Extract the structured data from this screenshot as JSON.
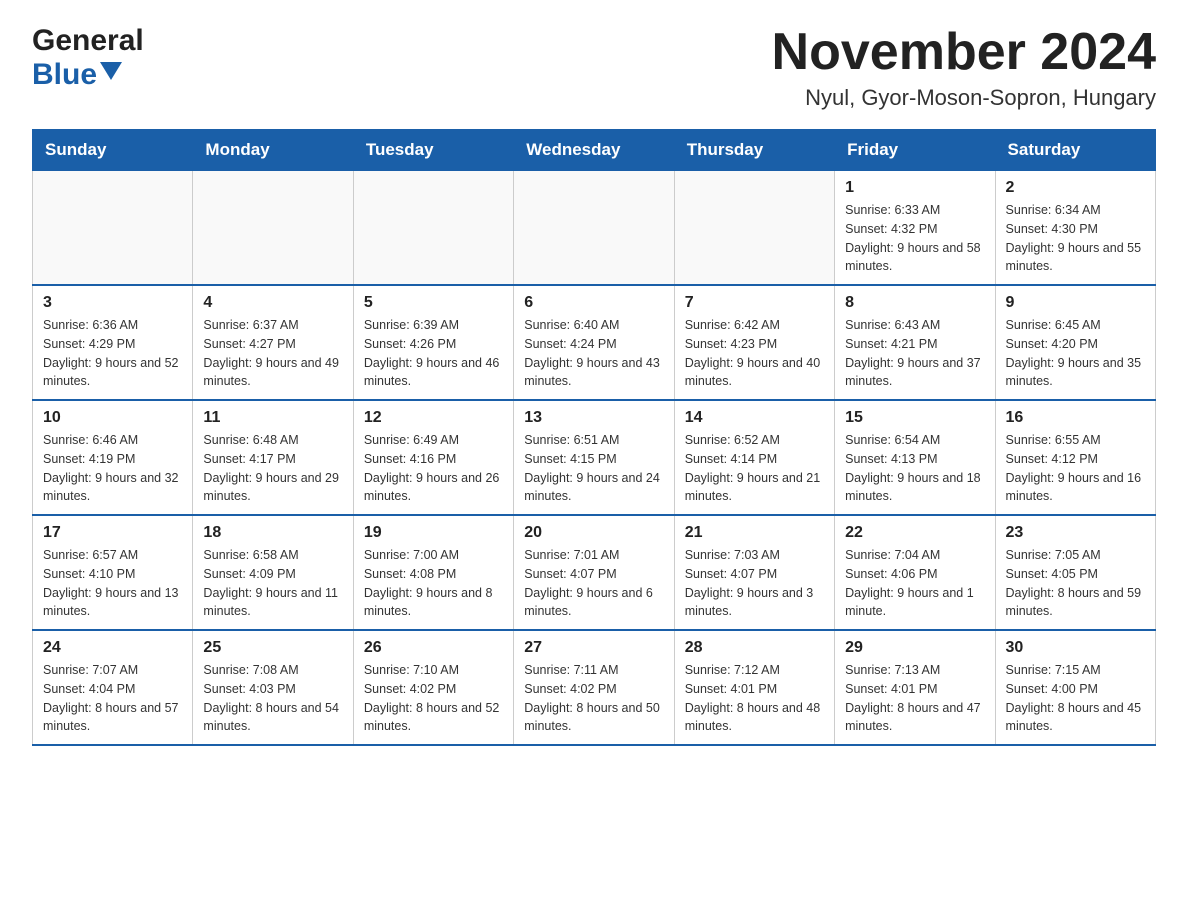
{
  "header": {
    "logo_general": "General",
    "logo_blue": "Blue",
    "month_title": "November 2024",
    "location": "Nyul, Gyor-Moson-Sopron, Hungary"
  },
  "calendar": {
    "days_of_week": [
      "Sunday",
      "Monday",
      "Tuesday",
      "Wednesday",
      "Thursday",
      "Friday",
      "Saturday"
    ],
    "weeks": [
      [
        {
          "day": "",
          "info": ""
        },
        {
          "day": "",
          "info": ""
        },
        {
          "day": "",
          "info": ""
        },
        {
          "day": "",
          "info": ""
        },
        {
          "day": "",
          "info": ""
        },
        {
          "day": "1",
          "info": "Sunrise: 6:33 AM\nSunset: 4:32 PM\nDaylight: 9 hours and 58 minutes."
        },
        {
          "day": "2",
          "info": "Sunrise: 6:34 AM\nSunset: 4:30 PM\nDaylight: 9 hours and 55 minutes."
        }
      ],
      [
        {
          "day": "3",
          "info": "Sunrise: 6:36 AM\nSunset: 4:29 PM\nDaylight: 9 hours and 52 minutes."
        },
        {
          "day": "4",
          "info": "Sunrise: 6:37 AM\nSunset: 4:27 PM\nDaylight: 9 hours and 49 minutes."
        },
        {
          "day": "5",
          "info": "Sunrise: 6:39 AM\nSunset: 4:26 PM\nDaylight: 9 hours and 46 minutes."
        },
        {
          "day": "6",
          "info": "Sunrise: 6:40 AM\nSunset: 4:24 PM\nDaylight: 9 hours and 43 minutes."
        },
        {
          "day": "7",
          "info": "Sunrise: 6:42 AM\nSunset: 4:23 PM\nDaylight: 9 hours and 40 minutes."
        },
        {
          "day": "8",
          "info": "Sunrise: 6:43 AM\nSunset: 4:21 PM\nDaylight: 9 hours and 37 minutes."
        },
        {
          "day": "9",
          "info": "Sunrise: 6:45 AM\nSunset: 4:20 PM\nDaylight: 9 hours and 35 minutes."
        }
      ],
      [
        {
          "day": "10",
          "info": "Sunrise: 6:46 AM\nSunset: 4:19 PM\nDaylight: 9 hours and 32 minutes."
        },
        {
          "day": "11",
          "info": "Sunrise: 6:48 AM\nSunset: 4:17 PM\nDaylight: 9 hours and 29 minutes."
        },
        {
          "day": "12",
          "info": "Sunrise: 6:49 AM\nSunset: 4:16 PM\nDaylight: 9 hours and 26 minutes."
        },
        {
          "day": "13",
          "info": "Sunrise: 6:51 AM\nSunset: 4:15 PM\nDaylight: 9 hours and 24 minutes."
        },
        {
          "day": "14",
          "info": "Sunrise: 6:52 AM\nSunset: 4:14 PM\nDaylight: 9 hours and 21 minutes."
        },
        {
          "day": "15",
          "info": "Sunrise: 6:54 AM\nSunset: 4:13 PM\nDaylight: 9 hours and 18 minutes."
        },
        {
          "day": "16",
          "info": "Sunrise: 6:55 AM\nSunset: 4:12 PM\nDaylight: 9 hours and 16 minutes."
        }
      ],
      [
        {
          "day": "17",
          "info": "Sunrise: 6:57 AM\nSunset: 4:10 PM\nDaylight: 9 hours and 13 minutes."
        },
        {
          "day": "18",
          "info": "Sunrise: 6:58 AM\nSunset: 4:09 PM\nDaylight: 9 hours and 11 minutes."
        },
        {
          "day": "19",
          "info": "Sunrise: 7:00 AM\nSunset: 4:08 PM\nDaylight: 9 hours and 8 minutes."
        },
        {
          "day": "20",
          "info": "Sunrise: 7:01 AM\nSunset: 4:07 PM\nDaylight: 9 hours and 6 minutes."
        },
        {
          "day": "21",
          "info": "Sunrise: 7:03 AM\nSunset: 4:07 PM\nDaylight: 9 hours and 3 minutes."
        },
        {
          "day": "22",
          "info": "Sunrise: 7:04 AM\nSunset: 4:06 PM\nDaylight: 9 hours and 1 minute."
        },
        {
          "day": "23",
          "info": "Sunrise: 7:05 AM\nSunset: 4:05 PM\nDaylight: 8 hours and 59 minutes."
        }
      ],
      [
        {
          "day": "24",
          "info": "Sunrise: 7:07 AM\nSunset: 4:04 PM\nDaylight: 8 hours and 57 minutes."
        },
        {
          "day": "25",
          "info": "Sunrise: 7:08 AM\nSunset: 4:03 PM\nDaylight: 8 hours and 54 minutes."
        },
        {
          "day": "26",
          "info": "Sunrise: 7:10 AM\nSunset: 4:02 PM\nDaylight: 8 hours and 52 minutes."
        },
        {
          "day": "27",
          "info": "Sunrise: 7:11 AM\nSunset: 4:02 PM\nDaylight: 8 hours and 50 minutes."
        },
        {
          "day": "28",
          "info": "Sunrise: 7:12 AM\nSunset: 4:01 PM\nDaylight: 8 hours and 48 minutes."
        },
        {
          "day": "29",
          "info": "Sunrise: 7:13 AM\nSunset: 4:01 PM\nDaylight: 8 hours and 47 minutes."
        },
        {
          "day": "30",
          "info": "Sunrise: 7:15 AM\nSunset: 4:00 PM\nDaylight: 8 hours and 45 minutes."
        }
      ]
    ]
  }
}
